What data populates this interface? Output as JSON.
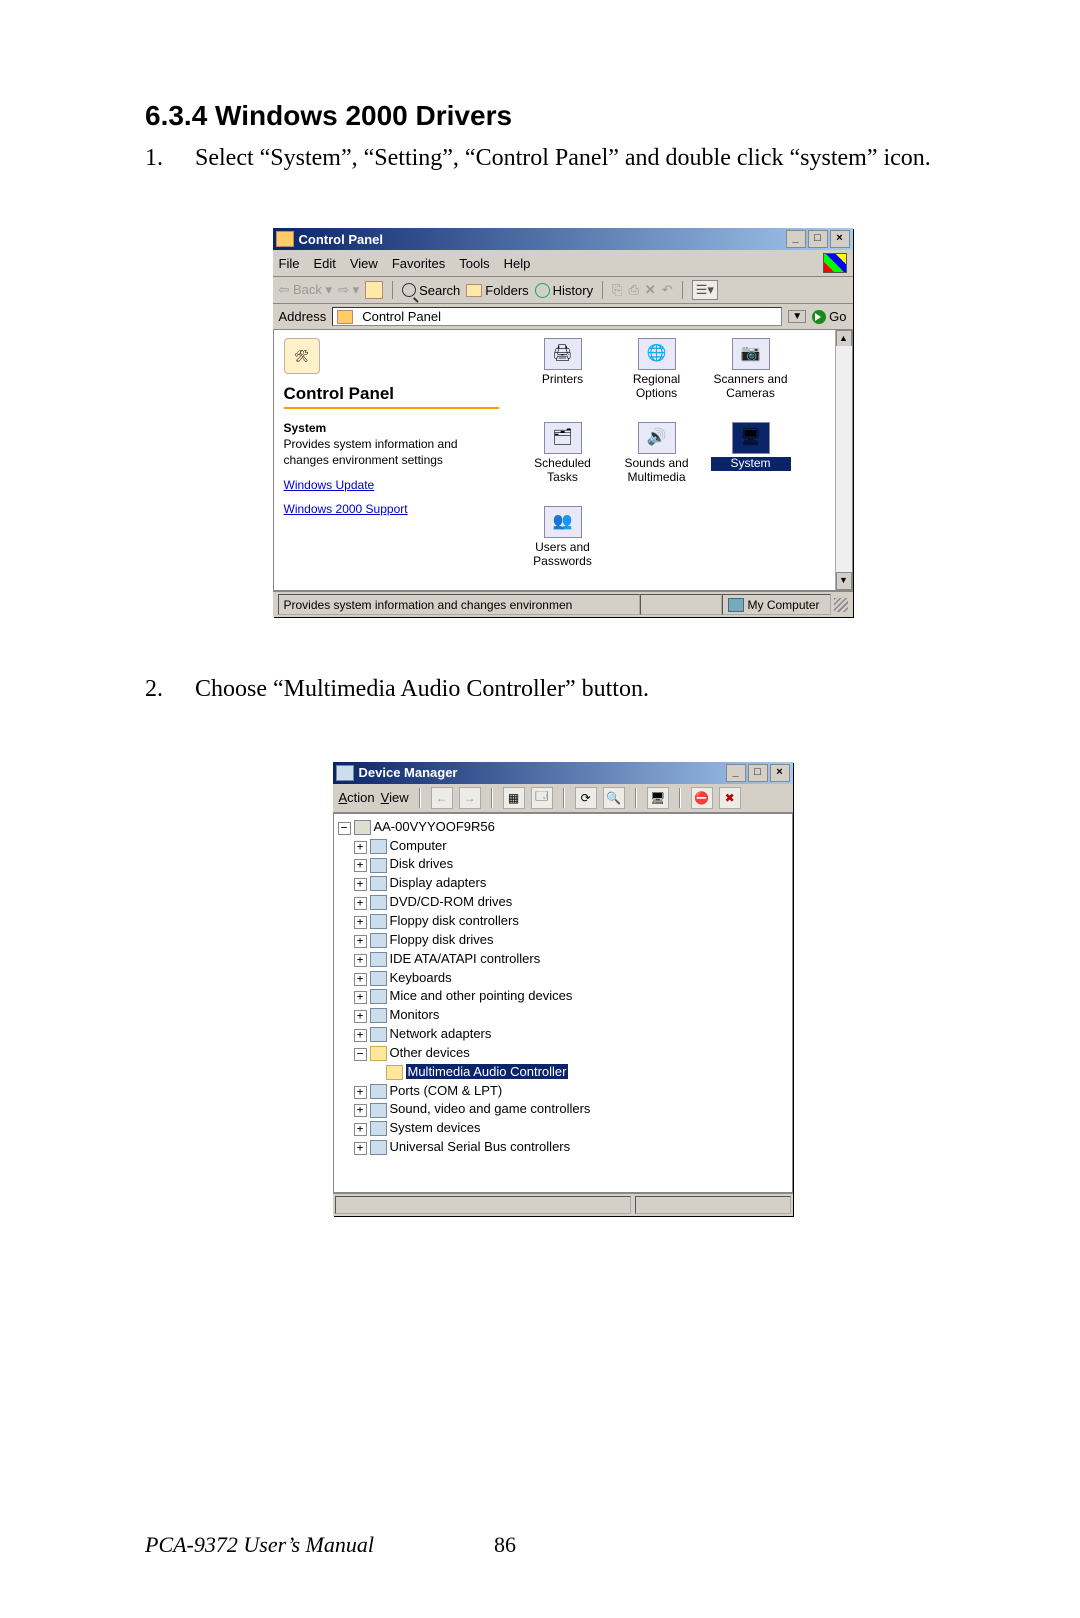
{
  "heading": "6.3.4 Windows 2000 Drivers",
  "step1_num": "1.",
  "step1_text": "Select “System”, “Setting”, “Control Panel” and double click “system” icon.",
  "step2_num": "2.",
  "step2_text": "Choose “Multimedia Audio Controller” button.",
  "footer_title": "PCA-9372 User’s Manual",
  "footer_page": "86",
  "cp": {
    "title": "Control Panel",
    "menu": {
      "file": "File",
      "edit": "Edit",
      "view": "View",
      "favorites": "Favorites",
      "tools": "Tools",
      "help": "Help"
    },
    "toolbar": {
      "back": "Back",
      "search": "Search",
      "folders": "Folders",
      "history": "History",
      "views_glyph": "☰▾"
    },
    "address_label": "Address",
    "address_value": "Control Panel",
    "go_label": "Go",
    "left_heading": "Control Panel",
    "left_sys_title": "System",
    "left_sys_desc": "Provides system information and changes environment settings",
    "link_winupdate": "Windows Update",
    "link_win2ksupport": "Windows 2000 Support",
    "items": {
      "printers": "Printers",
      "regional": "Regional Options",
      "scanners": "Scanners and Cameras",
      "scheduled": "Scheduled Tasks",
      "sounds": "Sounds and Multimedia",
      "system": "System",
      "users": "Users and Passwords"
    },
    "status_left": "Provides system information and changes environmen",
    "status_right": "My Computer"
  },
  "dm": {
    "title": "Device Manager",
    "menu_action": "Action",
    "menu_view": "View",
    "root": "AA-00VYYOOF9R56",
    "nodes": {
      "computer": "Computer",
      "disk": "Disk drives",
      "display": "Display adapters",
      "dvd": "DVD/CD-ROM drives",
      "floppyc": "Floppy disk controllers",
      "floppyd": "Floppy disk drives",
      "ide": "IDE ATA/ATAPI controllers",
      "keyboards": "Keyboards",
      "mice": "Mice and other pointing devices",
      "monitors": "Monitors",
      "network": "Network adapters",
      "other": "Other devices",
      "multimedia_audio": "Multimedia Audio Controller",
      "ports": "Ports (COM & LPT)",
      "sound": "Sound, video and game controllers",
      "sysdev": "System devices",
      "usb": "Universal Serial Bus controllers"
    }
  }
}
